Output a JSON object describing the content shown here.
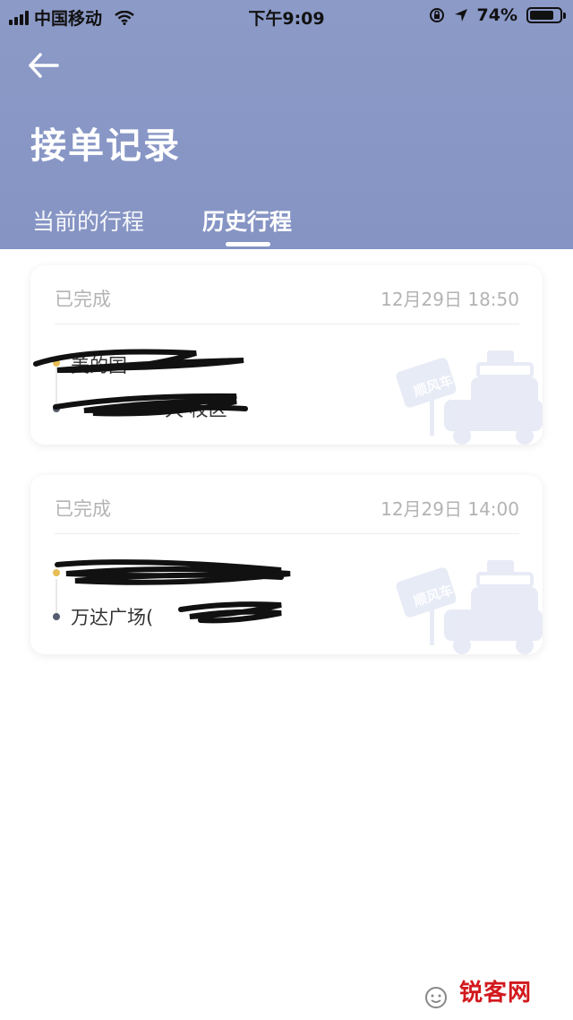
{
  "status_bar": {
    "carrier": "中国移动",
    "time": "下午9:09",
    "battery": "74%"
  },
  "header": {
    "title": "接单记录",
    "tabs": [
      {
        "label": "当前的行程",
        "active": false
      },
      {
        "label": "历史行程",
        "active": true
      }
    ]
  },
  "orders": [
    {
      "status": "已完成",
      "time": "12月29日 18:50",
      "start": "美的国",
      "end": "大 校区",
      "badge": "顺风车"
    },
    {
      "status": "已完成",
      "time": "12月29日 14:00",
      "start": "",
      "end": "万达广场(",
      "badge": "顺风车"
    }
  ],
  "watermark": "锐客网",
  "colors": {
    "header_bg": "#8594c4",
    "start_dot": "#e7bd55",
    "end_dot": "#565b6e",
    "watermark": "#d2191d"
  }
}
